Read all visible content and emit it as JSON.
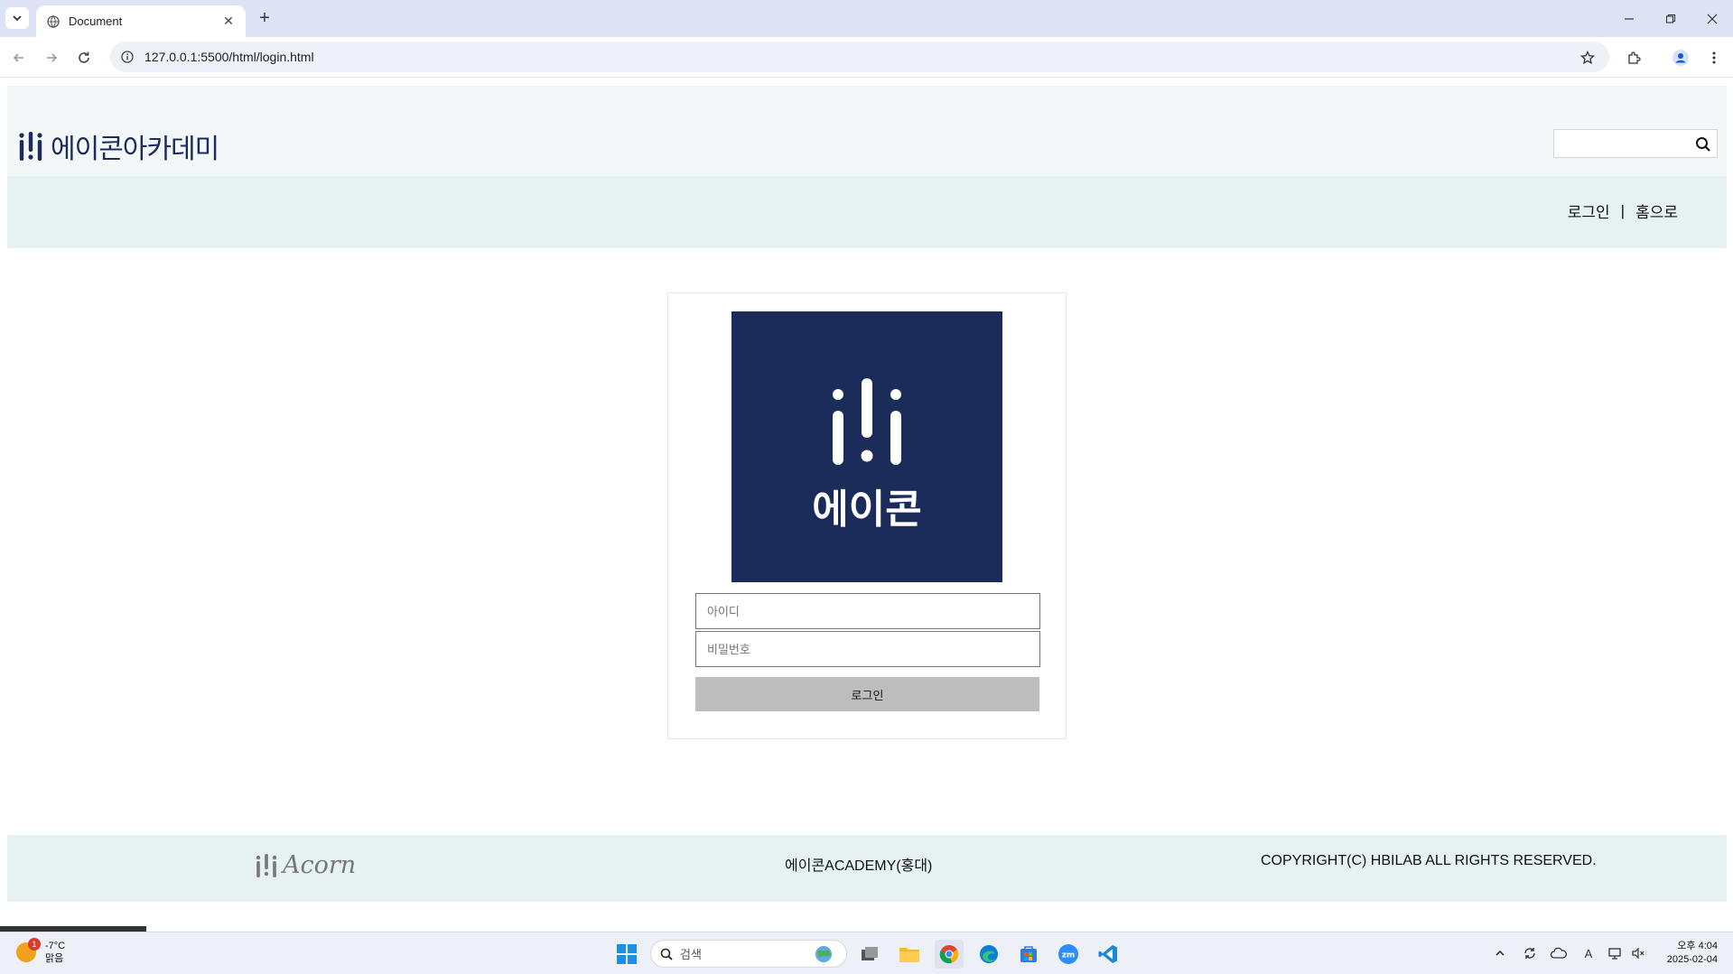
{
  "browser": {
    "tab_title": "Document",
    "url": "127.0.0.1:5500/html/login.html",
    "new_tab_label": "+",
    "tab_close_label": "✕"
  },
  "header": {
    "logo_text": "에이콘아카데미",
    "search_placeholder": ""
  },
  "nav": {
    "login_link": "로그인",
    "separator": "|",
    "home_link": "홈으로"
  },
  "login": {
    "brand_image_text": "에이콘",
    "id_placeholder": "아이디",
    "password_placeholder": "비밀번호",
    "submit_label": "로그인"
  },
  "footer": {
    "logo_text": "Acorn",
    "center_text": "에이콘ACADEMY(홍대)",
    "copyright": "COPYRIGHT(C) HBILAB ALL RIGHTS RESERVED."
  },
  "taskbar": {
    "weather_temp": "-7°C",
    "weather_desc": "맑음",
    "weather_badge": "1",
    "search_placeholder": "검색",
    "time": "오후 4:04",
    "date": "2025-02-04",
    "ime_indicator": "A"
  },
  "colors": {
    "brand_navy": "#1b2c5b",
    "header_bg": "#f3f7f8",
    "nav_bg": "#e6f1f1",
    "button_bg": "#bdbdbd"
  }
}
